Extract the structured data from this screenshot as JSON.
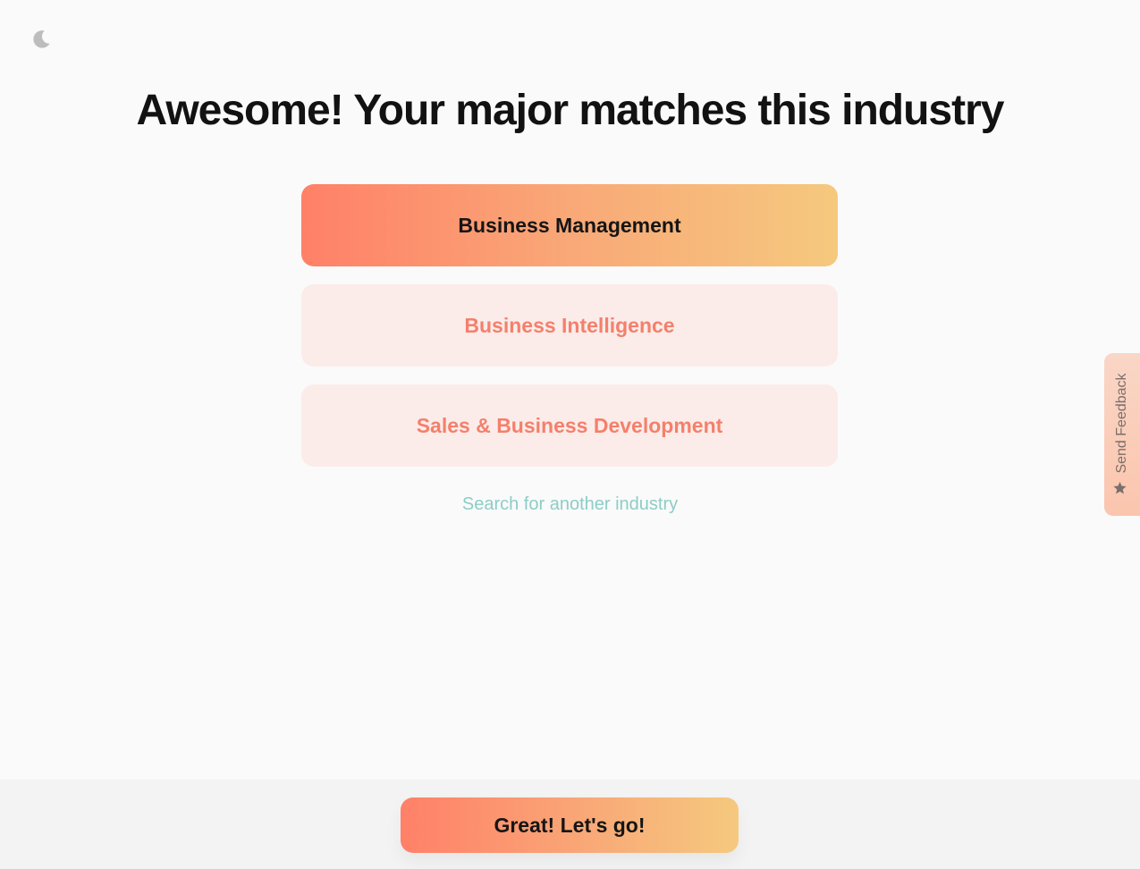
{
  "theme_toggle": {
    "icon": "moon-icon"
  },
  "title": "Awesome! Your major matches this industry",
  "options": [
    {
      "label": "Business Management",
      "selected": true
    },
    {
      "label": "Business Intelligence",
      "selected": false
    },
    {
      "label": "Sales & Business Development",
      "selected": false
    }
  ],
  "search_link": "Search for another industry",
  "feedback": {
    "label": "Send Feedback",
    "icon": "star-icon"
  },
  "cta": {
    "label": "Great! Let's go!"
  },
  "colors": {
    "accent_start": "#ff8068",
    "accent_end": "#f5c97e",
    "option_unselected_bg": "#fbecea",
    "option_unselected_text": "#f4806b",
    "link": "#8ccdc7"
  }
}
